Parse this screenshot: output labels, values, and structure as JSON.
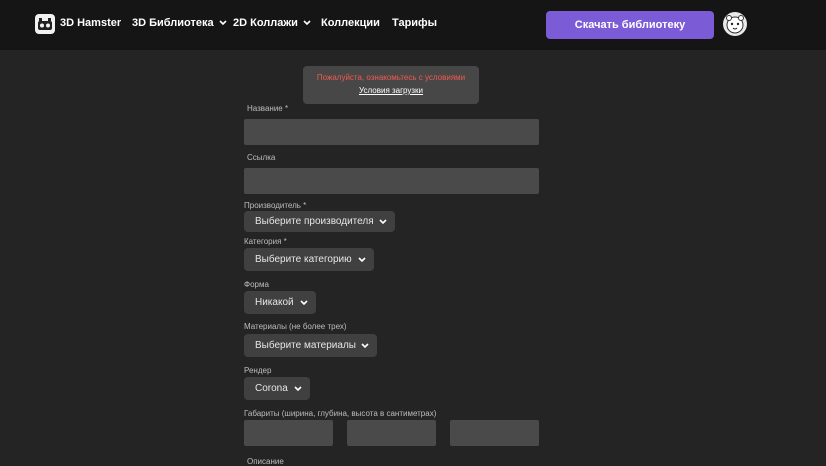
{
  "header": {
    "brand": "3D Hamster",
    "nav": [
      {
        "label": "3D Библиотека",
        "dropdown": true
      },
      {
        "label": "2D Коллажи",
        "dropdown": true
      },
      {
        "label": "Коллекции",
        "dropdown": false
      },
      {
        "label": "Тарифы",
        "dropdown": false
      }
    ],
    "download_button": "Скачать библиотеку",
    "avatar_icon": "user-avatar-icon"
  },
  "notice": {
    "warning": "Пожалуйста, ознакомьтесь с условиями",
    "link": "Условия загрузки"
  },
  "form": {
    "name_label": "Название *",
    "name_value": "",
    "link_label": "Ссылка",
    "link_value": "",
    "manufacturer_label": "Производитель *",
    "manufacturer_select": "Выберите производителя",
    "category_label": "Категория *",
    "category_select": "Выберите категорию",
    "shape_label": "Форма",
    "shape_select": "Никакой",
    "materials_label": "Материалы (не более трех)",
    "materials_select": "Выберите материалы",
    "render_label": "Рендер",
    "render_select": "Corona",
    "dimensions_label": "Габариты (ширина, глубина, высота в сантиметрах)",
    "dimensions_values": [
      "",
      "",
      ""
    ],
    "description_label": "Описание"
  },
  "colors": {
    "background": "#242424",
    "header": "#151515",
    "accent": "#7b5bd6",
    "warning": "#f05a4f"
  }
}
